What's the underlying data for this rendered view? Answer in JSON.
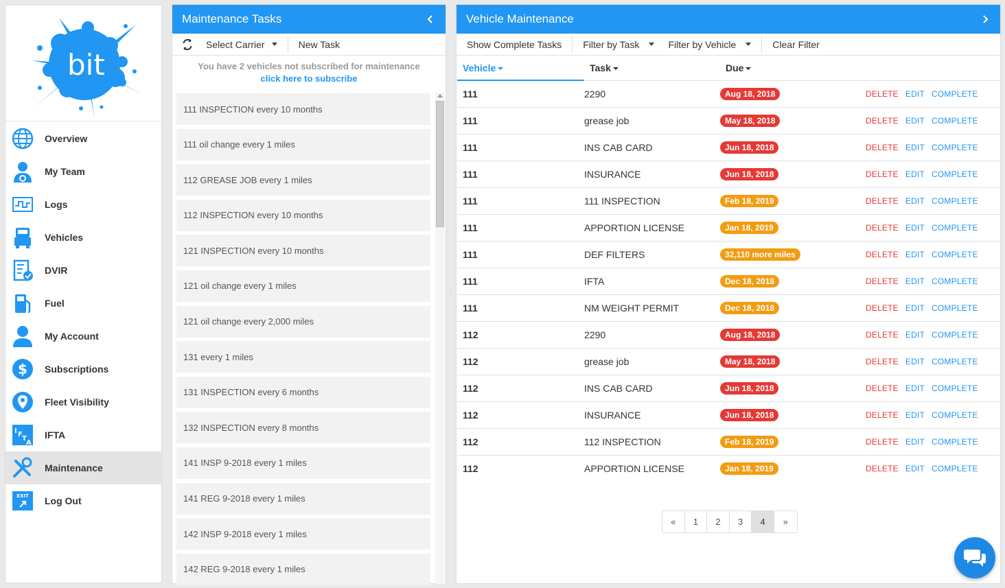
{
  "logo": {
    "text": "bit"
  },
  "nav": [
    {
      "label": "Overview",
      "icon": "globe-icon",
      "active": false
    },
    {
      "label": "My Team",
      "icon": "driver-icon",
      "active": false
    },
    {
      "label": "Logs",
      "icon": "logs-icon",
      "active": false
    },
    {
      "label": "Vehicles",
      "icon": "truck-icon",
      "active": false
    },
    {
      "label": "DVIR",
      "icon": "dvir-icon",
      "active": false
    },
    {
      "label": "Fuel",
      "icon": "fuel-icon",
      "active": false
    },
    {
      "label": "My Account",
      "icon": "user-icon",
      "active": false
    },
    {
      "label": "Subscriptions",
      "icon": "dollar-icon",
      "active": false
    },
    {
      "label": "Fleet Visibility",
      "icon": "location-pin-icon",
      "active": false
    },
    {
      "label": "IFTA",
      "icon": "ifta-icon",
      "active": false
    },
    {
      "label": "Maintenance",
      "icon": "wrench-icon",
      "active": true
    },
    {
      "label": "Log Out",
      "icon": "exit-icon",
      "active": false
    }
  ],
  "tasks_panel": {
    "title": "Maintenance Tasks",
    "toolbar": {
      "select_carrier": "Select Carrier",
      "new_task": "New Task"
    },
    "notice": "You have 2 vehicles not subscribed for maintenance",
    "subscribe_link": "click here to subscribe",
    "items": [
      "111 INSPECTION every 10 months",
      "111 oil change every 1 miles",
      "112 GREASE JOB every 1 miles",
      "112 INSPECTION every 10 months",
      "121 INSPECTION every 10 months",
      "121 oil change every 1 miles",
      "121 oil change every 2,000 miles",
      "131 every 1 miles",
      "131 INSPECTION every 6 months",
      "132 INSPECTION every 8 months",
      "141 INSP 9-2018 every 1 miles",
      "141 REG 9-2018 every 1 miles",
      "142 INSP 9-2018 every 1 miles",
      "142 REG 9-2018 every 1 miles"
    ]
  },
  "maint_panel": {
    "title": "Vehicle Maintenance",
    "toolbar": {
      "show_complete": "Show Complete Tasks",
      "filter_task": "Filter by Task",
      "filter_vehicle": "Filter by Vehicle",
      "clear_filter": "Clear Filter"
    },
    "columns": {
      "vehicle": "Vehicle",
      "task": "Task",
      "due": "Due"
    },
    "actions": {
      "delete": "DELETE",
      "edit": "EDIT",
      "complete": "COMPLETE"
    },
    "rows": [
      {
        "vehicle": "111",
        "task": "2290",
        "due": "Aug 18, 2018",
        "status": "red"
      },
      {
        "vehicle": "111",
        "task": "grease job",
        "due": "May 18, 2018",
        "status": "red"
      },
      {
        "vehicle": "111",
        "task": "INS CAB CARD",
        "due": "Jun 18, 2018",
        "status": "red"
      },
      {
        "vehicle": "111",
        "task": "INSURANCE",
        "due": "Jun 18, 2018",
        "status": "red"
      },
      {
        "vehicle": "111",
        "task": "111 INSPECTION",
        "due": "Feb 18, 2019",
        "status": "orange"
      },
      {
        "vehicle": "111",
        "task": "APPORTION LICENSE",
        "due": "Jan 18, 2019",
        "status": "orange"
      },
      {
        "vehicle": "111",
        "task": "DEF FILTERS",
        "due": "32,110 more miles",
        "status": "orange"
      },
      {
        "vehicle": "111",
        "task": "IFTA",
        "due": "Dec 18, 2018",
        "status": "orange"
      },
      {
        "vehicle": "111",
        "task": "NM WEIGHT PERMIT",
        "due": "Dec 18, 2018",
        "status": "orange"
      },
      {
        "vehicle": "112",
        "task": "2290",
        "due": "Aug 18, 2018",
        "status": "red"
      },
      {
        "vehicle": "112",
        "task": "grease job",
        "due": "May 18, 2018",
        "status": "red"
      },
      {
        "vehicle": "112",
        "task": "INS CAB CARD",
        "due": "Jun 18, 2018",
        "status": "red"
      },
      {
        "vehicle": "112",
        "task": "INSURANCE",
        "due": "Jun 18, 2018",
        "status": "red"
      },
      {
        "vehicle": "112",
        "task": "112 INSPECTION",
        "due": "Feb 18, 2019",
        "status": "orange"
      },
      {
        "vehicle": "112",
        "task": "APPORTION LICENSE",
        "due": "Jan 18, 2019",
        "status": "orange"
      }
    ],
    "pagination": [
      "«",
      "1",
      "2",
      "3",
      "4",
      "»"
    ],
    "current_page": "4"
  },
  "colors": {
    "accent": "#2196f3",
    "overdue": "#e53935",
    "upcoming": "#f39c12"
  }
}
